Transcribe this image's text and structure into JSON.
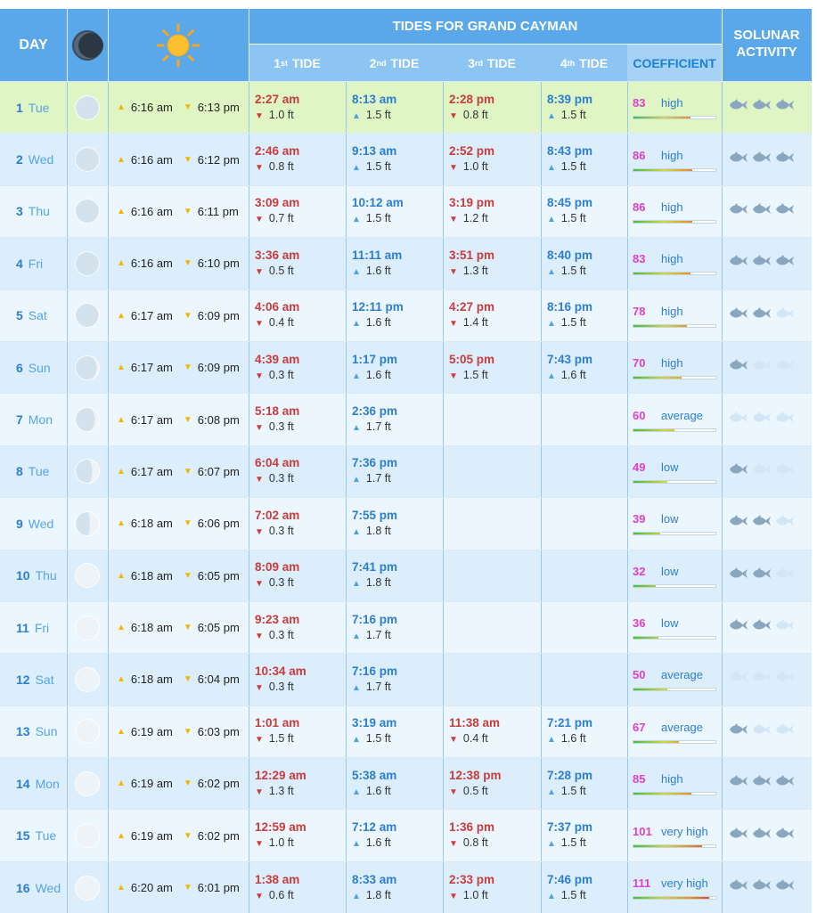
{
  "header": {
    "day": "DAY",
    "title": "TIDES FOR GRAND CAYMAN",
    "tide_labels": [
      {
        "num": "1",
        "sup": "st",
        "word": "TIDE"
      },
      {
        "num": "2",
        "sup": "nd",
        "word": "TIDE"
      },
      {
        "num": "3",
        "sup": "rd",
        "word": "TIDE"
      },
      {
        "num": "4",
        "sup": "th",
        "word": "TIDE"
      }
    ],
    "coefficient": "COEFFICIENT",
    "solunar_line1": "SOLUNAR",
    "solunar_line2": "ACTIVITY",
    "moon_icon": "moon-icon",
    "sun_icon": "sun-icon"
  },
  "colors": {
    "header_bg": "#5aa8ea",
    "subheader_bg": "#8cc4f3",
    "today_row": "#dff5c4",
    "low_tide": "#c93c3c",
    "high_tide": "#2c7fd0",
    "coefficient_value": "#e040c8",
    "fish_active": "#8aa7bf",
    "fish_inactive": "#d3e6f5"
  },
  "rows": [
    {
      "num": "1",
      "wd": "Tue",
      "moon": 0.02,
      "sunrise": "6:16 am",
      "sunset": "6:13 pm",
      "today": true,
      "tides": [
        {
          "time": "2:27 am",
          "h": "1.0",
          "type": "low"
        },
        {
          "time": "8:13 am",
          "h": "1.5",
          "type": "high"
        },
        {
          "time": "2:28 pm",
          "h": "0.8",
          "type": "low"
        },
        {
          "time": "8:39 pm",
          "h": "1.5",
          "type": "high"
        }
      ],
      "coef": "83",
      "level": "high",
      "fish": [
        1,
        1,
        1
      ]
    },
    {
      "num": "2",
      "wd": "Wed",
      "moon": 0.01,
      "sunrise": "6:16 am",
      "sunset": "6:12 pm",
      "tides": [
        {
          "time": "2:46 am",
          "h": "0.8",
          "type": "low"
        },
        {
          "time": "9:13 am",
          "h": "1.5",
          "type": "high"
        },
        {
          "time": "2:52 pm",
          "h": "1.0",
          "type": "low"
        },
        {
          "time": "8:43 pm",
          "h": "1.5",
          "type": "high"
        }
      ],
      "coef": "86",
      "level": "high",
      "fish": [
        1,
        1,
        1
      ]
    },
    {
      "num": "3",
      "wd": "Thu",
      "moon": 0.0,
      "sunrise": "6:16 am",
      "sunset": "6:11 pm",
      "tides": [
        {
          "time": "3:09 am",
          "h": "0.7",
          "type": "low"
        },
        {
          "time": "10:12 am",
          "h": "1.5",
          "type": "high"
        },
        {
          "time": "3:19 pm",
          "h": "1.2",
          "type": "low"
        },
        {
          "time": "8:45 pm",
          "h": "1.5",
          "type": "high"
        }
      ],
      "coef": "86",
      "level": "high",
      "fish": [
        1,
        1,
        1
      ]
    },
    {
      "num": "4",
      "wd": "Fri",
      "moon": 0.02,
      "sunrise": "6:16 am",
      "sunset": "6:10 pm",
      "tides": [
        {
          "time": "3:36 am",
          "h": "0.5",
          "type": "low"
        },
        {
          "time": "11:11 am",
          "h": "1.6",
          "type": "high"
        },
        {
          "time": "3:51 pm",
          "h": "1.3",
          "type": "low"
        },
        {
          "time": "8:40 pm",
          "h": "1.5",
          "type": "high"
        }
      ],
      "coef": "83",
      "level": "high",
      "fish": [
        1,
        1,
        1
      ]
    },
    {
      "num": "5",
      "wd": "Sat",
      "moon": 0.06,
      "sunrise": "6:17 am",
      "sunset": "6:09 pm",
      "tides": [
        {
          "time": "4:06 am",
          "h": "0.4",
          "type": "low"
        },
        {
          "time": "12:11 pm",
          "h": "1.6",
          "type": "high"
        },
        {
          "time": "4:27 pm",
          "h": "1.4",
          "type": "low"
        },
        {
          "time": "8:16 pm",
          "h": "1.5",
          "type": "high"
        }
      ],
      "coef": "78",
      "level": "high",
      "fish": [
        1,
        1,
        0
      ]
    },
    {
      "num": "6",
      "wd": "Sun",
      "moon": 0.12,
      "sunrise": "6:17 am",
      "sunset": "6:09 pm",
      "tides": [
        {
          "time": "4:39 am",
          "h": "0.3",
          "type": "low"
        },
        {
          "time": "1:17 pm",
          "h": "1.6",
          "type": "high"
        },
        {
          "time": "5:05 pm",
          "h": "1.5",
          "type": "low"
        },
        {
          "time": "7:43 pm",
          "h": "1.6",
          "type": "high"
        }
      ],
      "coef": "70",
      "level": "high",
      "fish": [
        1,
        0,
        0
      ]
    },
    {
      "num": "7",
      "wd": "Mon",
      "moon": 0.2,
      "sunrise": "6:17 am",
      "sunset": "6:08 pm",
      "tides": [
        {
          "time": "5:18 am",
          "h": "0.3",
          "type": "low"
        },
        {
          "time": "2:36 pm",
          "h": "1.7",
          "type": "high"
        }
      ],
      "coef": "60",
      "level": "average",
      "fish": [
        0,
        0,
        0
      ]
    },
    {
      "num": "8",
      "wd": "Tue",
      "moon": 0.3,
      "sunrise": "6:17 am",
      "sunset": "6:07 pm",
      "tides": [
        {
          "time": "6:04 am",
          "h": "0.3",
          "type": "low"
        },
        {
          "time": "7:36 pm",
          "h": "1.7",
          "type": "high"
        }
      ],
      "coef": "49",
      "level": "low",
      "fish": [
        1,
        0,
        0
      ]
    },
    {
      "num": "9",
      "wd": "Wed",
      "moon": 0.4,
      "sunrise": "6:18 am",
      "sunset": "6:06 pm",
      "tides": [
        {
          "time": "7:02 am",
          "h": "0.3",
          "type": "low"
        },
        {
          "time": "7:55 pm",
          "h": "1.8",
          "type": "high"
        }
      ],
      "coef": "39",
      "level": "low",
      "fish": [
        1,
        1,
        0
      ]
    },
    {
      "num": "10",
      "wd": "Thu",
      "moon": 0.5,
      "sunrise": "6:18 am",
      "sunset": "6:05 pm",
      "tides": [
        {
          "time": "8:09 am",
          "h": "0.3",
          "type": "low"
        },
        {
          "time": "7:41 pm",
          "h": "1.8",
          "type": "high"
        }
      ],
      "coef": "32",
      "level": "low",
      "fish": [
        1,
        1,
        0
      ]
    },
    {
      "num": "11",
      "wd": "Fri",
      "moon": 0.6,
      "sunrise": "6:18 am",
      "sunset": "6:05 pm",
      "tides": [
        {
          "time": "9:23 am",
          "h": "0.3",
          "type": "low"
        },
        {
          "time": "7:16 pm",
          "h": "1.7",
          "type": "high"
        }
      ],
      "coef": "36",
      "level": "low",
      "fish": [
        1,
        1,
        0
      ]
    },
    {
      "num": "12",
      "wd": "Sat",
      "moon": 0.7,
      "sunrise": "6:18 am",
      "sunset": "6:04 pm",
      "tides": [
        {
          "time": "10:34 am",
          "h": "0.3",
          "type": "low"
        },
        {
          "time": "7:16 pm",
          "h": "1.7",
          "type": "high"
        }
      ],
      "coef": "50",
      "level": "average",
      "fish": [
        0,
        0,
        0
      ]
    },
    {
      "num": "13",
      "wd": "Sun",
      "moon": 0.8,
      "sunrise": "6:19 am",
      "sunset": "6:03 pm",
      "tides": [
        {
          "time": "1:01 am",
          "h": "1.5",
          "type": "low"
        },
        {
          "time": "3:19 am",
          "h": "1.5",
          "type": "high"
        },
        {
          "time": "11:38 am",
          "h": "0.4",
          "type": "low"
        },
        {
          "time": "7:21 pm",
          "h": "1.6",
          "type": "high"
        }
      ],
      "coef": "67",
      "level": "average",
      "fish": [
        1,
        0,
        0
      ]
    },
    {
      "num": "14",
      "wd": "Mon",
      "moon": 0.88,
      "sunrise": "6:19 am",
      "sunset": "6:02 pm",
      "tides": [
        {
          "time": "12:29 am",
          "h": "1.3",
          "type": "low"
        },
        {
          "time": "5:38 am",
          "h": "1.6",
          "type": "high"
        },
        {
          "time": "12:38 pm",
          "h": "0.5",
          "type": "low"
        },
        {
          "time": "7:28 pm",
          "h": "1.5",
          "type": "high"
        }
      ],
      "coef": "85",
      "level": "high",
      "fish": [
        1,
        1,
        1
      ]
    },
    {
      "num": "15",
      "wd": "Tue",
      "moon": 0.95,
      "sunrise": "6:19 am",
      "sunset": "6:02 pm",
      "tides": [
        {
          "time": "12:59 am",
          "h": "1.0",
          "type": "low"
        },
        {
          "time": "7:12 am",
          "h": "1.6",
          "type": "high"
        },
        {
          "time": "1:36 pm",
          "h": "0.8",
          "type": "low"
        },
        {
          "time": "7:37 pm",
          "h": "1.5",
          "type": "high"
        }
      ],
      "coef": "101",
      "level": "very high",
      "fish": [
        1,
        1,
        1
      ]
    },
    {
      "num": "16",
      "wd": "Wed",
      "moon": 1.0,
      "sunrise": "6:20 am",
      "sunset": "6:01 pm",
      "tides": [
        {
          "time": "1:38 am",
          "h": "0.6",
          "type": "low"
        },
        {
          "time": "8:33 am",
          "h": "1.8",
          "type": "high"
        },
        {
          "time": "2:33 pm",
          "h": "1.0",
          "type": "low"
        },
        {
          "time": "7:46 pm",
          "h": "1.5",
          "type": "high"
        }
      ],
      "coef": "111",
      "level": "very high",
      "fish": [
        1,
        1,
        1
      ]
    }
  ],
  "units": {
    "feet": "ft"
  },
  "coef_max": 120
}
